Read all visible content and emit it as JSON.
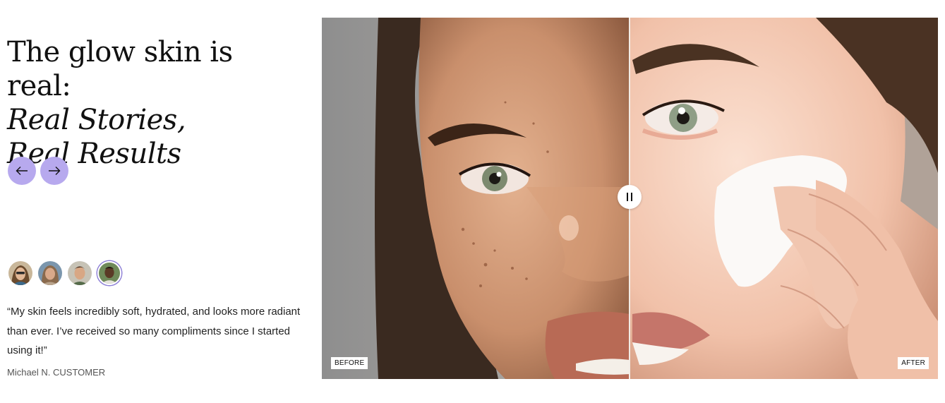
{
  "heading": {
    "line1": "The glow skin is real:",
    "line2": "Real Stories, Real Results"
  },
  "nav": {
    "prev_icon": "arrow-left-icon",
    "next_icon": "arrow-right-icon",
    "color": "#b7a9ee"
  },
  "avatars": [
    {
      "name": "avatar-1",
      "active": false
    },
    {
      "name": "avatar-2",
      "active": false
    },
    {
      "name": "avatar-3",
      "active": false
    },
    {
      "name": "avatar-4",
      "active": true
    }
  ],
  "testimonial": {
    "quote": "“My skin feels incredibly soft, hydrated, and looks more radiant than ever. I’ve received so many compliments since I started using it!”",
    "author": "Michael N. CUSTOMER"
  },
  "comparison": {
    "before_label": "BEFORE",
    "after_label": "AFTER",
    "handle_icon": "pause-icon",
    "divider_position": 0.5
  }
}
